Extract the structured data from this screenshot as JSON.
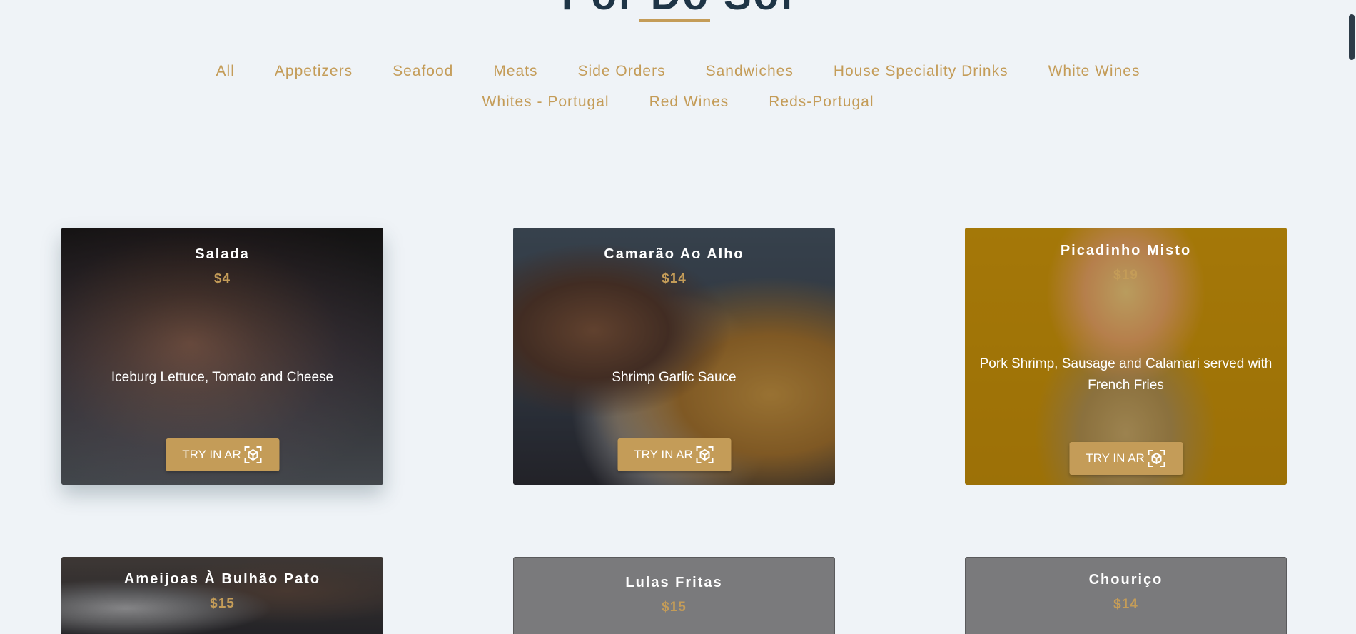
{
  "header": {
    "title": "Pôr Do Sol"
  },
  "filters": {
    "row1": [
      "All",
      "Appetizers",
      "Seafood",
      "Meats",
      "Side Orders",
      "Sandwiches",
      "House Speciality Drinks",
      "White Wines"
    ],
    "row2": [
      "Whites - Portugal",
      "Red Wines",
      "Reds-Portugal"
    ]
  },
  "cards": [
    {
      "name": "Salada",
      "price": "$4",
      "description": "Iceburg Lettuce, Tomato and Cheese",
      "button": "TRY IN AR"
    },
    {
      "name": "Camarão Ao Alho",
      "price": "$14",
      "description": "Shrimp Garlic Sauce",
      "button": "TRY IN AR"
    },
    {
      "name": "Picadinho Misto",
      "price": "$19",
      "description": "Pork Shrimp, Sausage and Calamari served with French Fries",
      "button": "TRY IN AR"
    },
    {
      "name": "Ameijoas À Bulhão Pato",
      "price": "$15"
    },
    {
      "name": "Lulas Fritas",
      "price": "$15"
    },
    {
      "name": "Chouriço",
      "price": "$14"
    }
  ],
  "colors": {
    "accent": "#c49c58",
    "heading": "#1e3446",
    "background": "#eff3f7"
  }
}
